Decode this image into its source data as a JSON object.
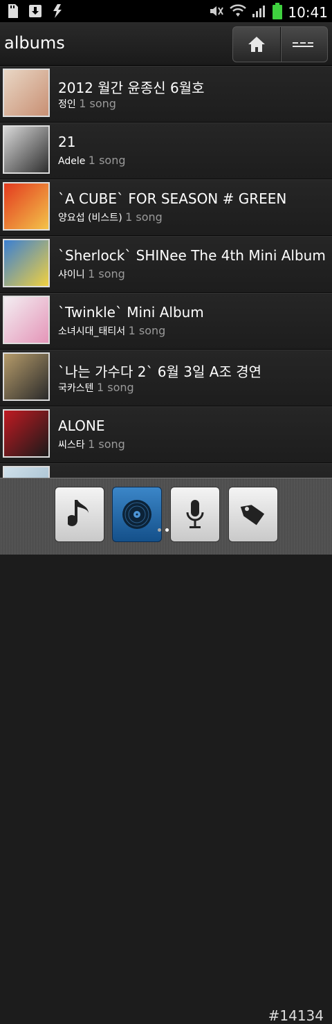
{
  "status_bar": {
    "time": "10:41",
    "left_icons": [
      "sd-card-icon",
      "download-icon",
      "usb-icon"
    ],
    "right_icons": [
      "mute-icon",
      "wifi-icon",
      "signal-icon",
      "battery-icon"
    ]
  },
  "header": {
    "title": "albums",
    "buttons": [
      "home-icon",
      "menu-icon"
    ]
  },
  "albums": [
    {
      "title": "2012 월간 윤종신 6월호",
      "artist": "정인",
      "count": "1 song",
      "cover": [
        "#e9d7c5",
        "#c88f73"
      ]
    },
    {
      "title": "21",
      "artist": "Adele",
      "count": "1 song",
      "cover": [
        "#d8d8d8",
        "#2e2e2e"
      ]
    },
    {
      "title": "`A CUBE` FOR SEASON # GREEN",
      "artist": "양요섭 (비스트)",
      "count": "1 song",
      "cover": [
        "#e33a1f",
        "#f3c34a"
      ]
    },
    {
      "title": "`Sherlock` SHINee The 4th Mini Album",
      "artist": "샤이니",
      "count": "1 song",
      "cover": [
        "#3a7fd3",
        "#f0d040"
      ]
    },
    {
      "title": "`Twinkle` Mini Album",
      "artist": "소녀시대_태티서",
      "count": "1 song",
      "cover": [
        "#f3eef2",
        "#e495b8"
      ]
    },
    {
      "title": "`나는 가수다 2` 6월 3일 A조 경연",
      "artist": "국카스텐",
      "count": "1 song",
      "cover": [
        "#b59b6a",
        "#2a2a2a"
      ]
    },
    {
      "title": "ALONE",
      "artist": "씨스타",
      "count": "1 song",
      "cover": [
        "#c01a22",
        "#1a1a1a"
      ]
    },
    {
      "title": "",
      "artist": "",
      "count": "",
      "cover": [
        "#cfe0ea",
        "#9bb7c9"
      ]
    }
  ],
  "tabs": [
    {
      "icon": "music-note-icon",
      "active": false
    },
    {
      "icon": "album-disc-icon",
      "active": true
    },
    {
      "icon": "microphone-icon",
      "active": false
    },
    {
      "icon": "tag-icon",
      "active": false
    }
  ],
  "page_indicator": {
    "pages": 2,
    "current": 2
  },
  "watermark": "#14134",
  "colors": {
    "accent": "#2f7dc2",
    "background": "#1c1c1c",
    "battery": "#3fd13f"
  }
}
